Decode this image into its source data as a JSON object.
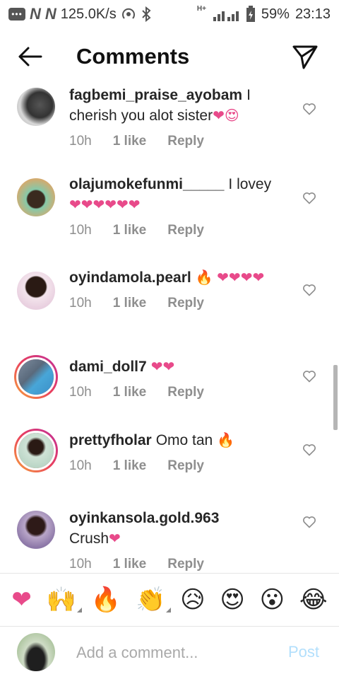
{
  "status_bar": {
    "network_speed": "125.0K/s",
    "battery": "59%",
    "time": "23:13",
    "hplus": "H+"
  },
  "header": {
    "title": "Comments"
  },
  "comments": [
    {
      "username": "fagbemi_praise_ayobam",
      "text": "I cherish you alot sister",
      "emojis": "❤😍",
      "time": "10h",
      "likes": "1 like",
      "reply": "Reply",
      "story_ring": false
    },
    {
      "username": "olajumokefunmi_____",
      "text": "I lovey",
      "emojis": "❤❤❤❤❤❤",
      "time": "10h",
      "likes": "1 like",
      "reply": "Reply",
      "story_ring": false
    },
    {
      "username": "oyindamola.pearl",
      "text": "",
      "emojis": "🔥 ❤❤❤❤",
      "time": "10h",
      "likes": "1 like",
      "reply": "Reply",
      "story_ring": false
    },
    {
      "username": "dami_doll7",
      "text": "",
      "emojis": "❤❤",
      "time": "10h",
      "likes": "1 like",
      "reply": "Reply",
      "story_ring": true
    },
    {
      "username": "prettyfholar",
      "text": "Omo tan",
      "emojis": "🔥",
      "time": "10h",
      "likes": "1 like",
      "reply": "Reply",
      "story_ring": true
    },
    {
      "username": "oyinkansola.gold.963",
      "text": "Crush",
      "emojis": "❤",
      "time": "10h",
      "likes": "1 like",
      "reply": "Reply",
      "story_ring": false
    }
  ],
  "reactions": [
    "❤",
    "🙌",
    "🔥",
    "👏",
    "😥",
    "😍",
    "😮",
    "😂"
  ],
  "composer": {
    "placeholder": "Add a comment...",
    "post_label": "Post"
  },
  "colors": {
    "heart_pink": "#e84a8a",
    "link_blue_disabled": "#b2dffc",
    "meta_grey": "#8e8e8e"
  }
}
